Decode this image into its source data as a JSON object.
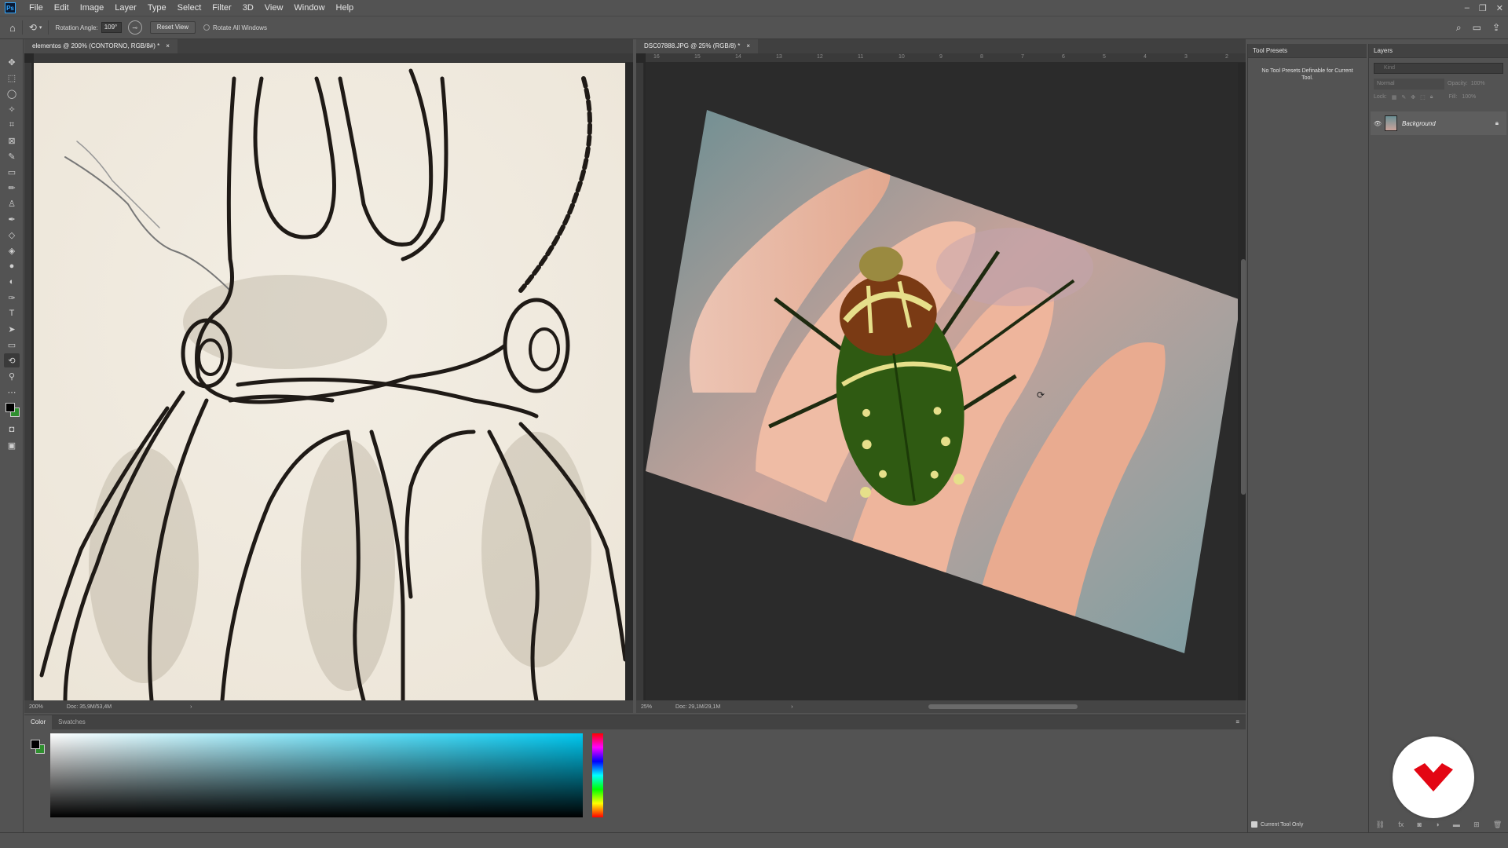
{
  "app": {
    "logo_text": "Ps",
    "menu": [
      "File",
      "Edit",
      "Image",
      "Layer",
      "Type",
      "Select",
      "Filter",
      "3D",
      "View",
      "Window",
      "Help"
    ],
    "window_controls": [
      "–",
      "❐",
      "✕"
    ]
  },
  "options_bar": {
    "rotation_label": "Rotation Angle:",
    "rotation_value": "109°",
    "reset_view": "Reset View",
    "rotate_all": "Rotate All Windows"
  },
  "toolbar": {
    "tools": [
      "move-tool-icon",
      "marquee-tool-icon",
      "lasso-tool-icon",
      "magic-wand-icon",
      "crop-tool-icon",
      "frame-tool-icon",
      "eyedropper-icon",
      "spot-healing-icon",
      "brush-tool-icon",
      "clone-stamp-icon",
      "history-brush-icon",
      "eraser-icon",
      "gradient-tool-icon",
      "blur-tool-icon",
      "dodge-tool-icon",
      "pen-tool-icon",
      "type-tool-icon",
      "path-selection-icon",
      "rectangle-tool-icon",
      "rotate-view-icon",
      "zoom-tool-icon",
      "more-tools-icon"
    ],
    "active": "rotate-view-icon"
  },
  "doc_left": {
    "tab": "elementos @ 200% (CONTORNO, RGB/8#) *",
    "zoom": "200%",
    "doc_size": "Doc: 35,9M/53,4M"
  },
  "doc_right": {
    "tab": "DSC07888.JPG @ 25% (RGB/8) *",
    "zoom": "25%",
    "doc_size": "Doc: 29,1M/29,1M",
    "ruler_labels": [
      "16",
      "15",
      "14",
      "13",
      "12",
      "11",
      "10",
      "9",
      "8",
      "7",
      "6",
      "5",
      "4",
      "3",
      "2"
    ]
  },
  "tool_presets": {
    "tab": "Tool Presets",
    "message": "No Tool Presets Definable for Current Tool.",
    "footer_checkbox": "Current Tool Only"
  },
  "layers": {
    "tab": "Layers",
    "search_placeholder": "Kind",
    "blend_mode": "Normal",
    "opacity_label": "Opacity:",
    "opacity_value": "100%",
    "lock_label": "Lock:",
    "fill_label": "Fill:",
    "fill_value": "100%",
    "items": [
      {
        "name": "Background",
        "locked": true,
        "visible": true
      }
    ]
  },
  "color_panel": {
    "tabs": [
      "Color",
      "Swatches"
    ],
    "active_tab": "Color"
  },
  "colors": {
    "foreground": "#000000",
    "background": "#2f8f2f",
    "hue_accent": "#00c8f0",
    "brand_red": "#e30613"
  }
}
